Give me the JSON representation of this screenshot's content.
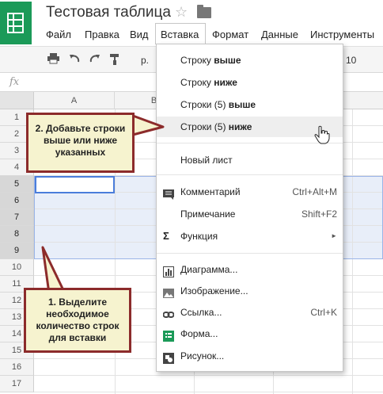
{
  "header": {
    "title": "Тестовая таблица",
    "menu": [
      "Файл",
      "Правка",
      "Вид",
      "Вставка",
      "Формат",
      "Данные",
      "Инструменты"
    ]
  },
  "toolbar": {
    "font_name": "р.",
    "font_size": "10"
  },
  "formula_bar": {
    "fx_label": "fx"
  },
  "columns": [
    "A",
    "B"
  ],
  "rows": [
    "1",
    "2",
    "3",
    "4",
    "5",
    "6",
    "7",
    "8",
    "9",
    "10",
    "11",
    "12",
    "13",
    "14",
    "15",
    "16",
    "17"
  ],
  "insert_menu": {
    "row_above": {
      "pre": "Строку ",
      "bold": "выше"
    },
    "row_below": {
      "pre": "Строку ",
      "bold": "ниже"
    },
    "rows_above": {
      "pre": "Строки (5) ",
      "bold": "выше"
    },
    "rows_below": {
      "pre": "Строки (5) ",
      "bold": "ниже"
    },
    "new_sheet": "Новый лист",
    "comment": {
      "label": "Комментарий",
      "shortcut": "Ctrl+Alt+M"
    },
    "note": {
      "label": "Примечание",
      "shortcut": "Shift+F2"
    },
    "function": {
      "label": "Функция",
      "arrow": "►"
    },
    "chart": "Диаграмма...",
    "image": "Изображение...",
    "link": {
      "label": "Ссылка...",
      "shortcut": "Ctrl+K"
    },
    "form": "Форма...",
    "drawing": "Рисунок..."
  },
  "callouts": {
    "step2": "2. Добавьте строки выше или ниже указанных",
    "step1": "1. Выделите необходимое количество строк для вставки"
  },
  "colors": {
    "accent": "#1b9a58",
    "callout_border": "#8c2b2b",
    "callout_bg": "#f6f3cf",
    "selection": "#e8eef9"
  }
}
